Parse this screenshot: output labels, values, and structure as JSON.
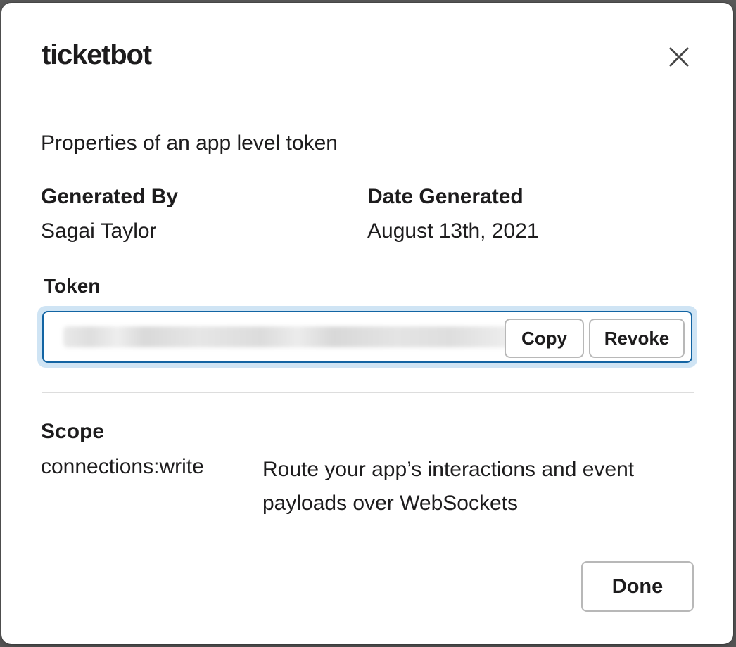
{
  "modal": {
    "title": "ticketbot",
    "close_icon": "close-icon",
    "description": "Properties of an app level token",
    "generated_by": {
      "label": "Generated By",
      "value": "Sagai Taylor"
    },
    "date_generated": {
      "label": "Date Generated",
      "value": "August 13th, 2021"
    },
    "token": {
      "label": "Token",
      "copy_label": "Copy",
      "revoke_label": "Revoke"
    },
    "scope": {
      "label": "Scope",
      "name": "connections:write",
      "description": "Route your app’s interactions and event payloads over WebSockets"
    },
    "done_label": "Done"
  },
  "colors": {
    "focus_border": "#1264a3",
    "focus_ring": "#cfe4f4",
    "text": "#1d1c1d"
  }
}
